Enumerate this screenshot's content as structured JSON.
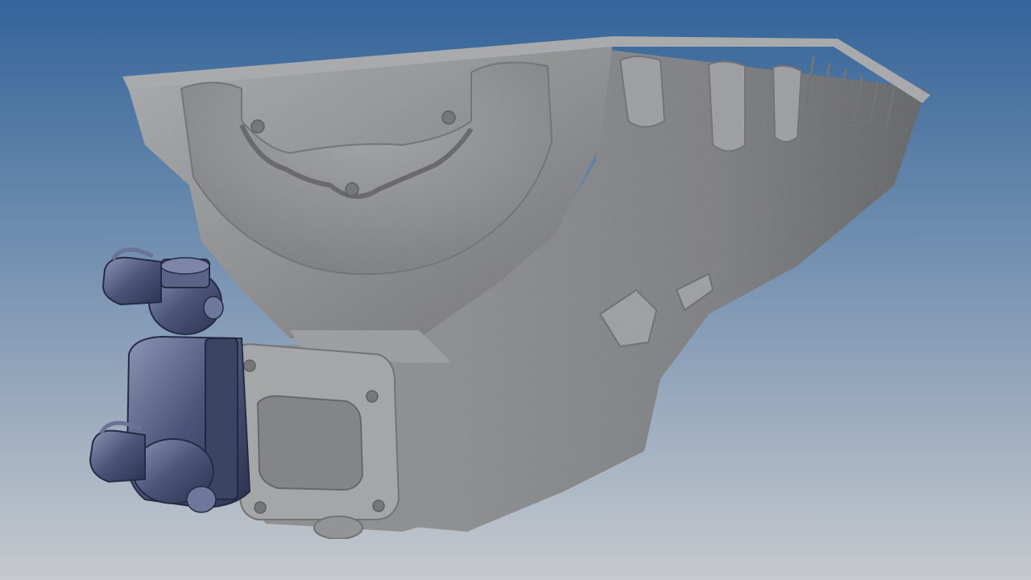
{
  "scene": {
    "background_top_color": "#33649a",
    "background_bottom_color": "#c6c9cd",
    "cast_metal_color": "#8e8f91",
    "cast_highlight_color": "#b4b5b7",
    "cast_shadow_color": "#5f6063",
    "actuator_color": "#4a5578",
    "actuator_highlight_color": "#8b95b5"
  },
  "model": {
    "parts": [
      {
        "name": "cast-oil-pan",
        "material": "textured-cast-aluminum"
      },
      {
        "name": "actuator-assembly",
        "material": "blue-grey-metal"
      }
    ]
  }
}
